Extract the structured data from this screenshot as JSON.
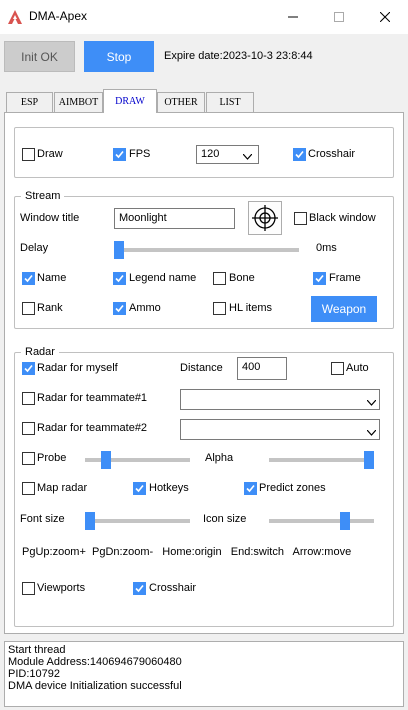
{
  "window": {
    "title": "DMA-Apex",
    "icons": {
      "app": "apex-logo-icon",
      "minimize": "minimize-icon",
      "maximize": "maximize-icon",
      "close": "close-icon"
    }
  },
  "top": {
    "init_label": "Init OK",
    "stop_label": "Stop",
    "expire_text": "Expire date:2023-10-3 23:8:44"
  },
  "tabs": [
    {
      "label": "ESP",
      "active": false
    },
    {
      "label": "AIMBOT",
      "active": false
    },
    {
      "label": "DRAW",
      "active": true
    },
    {
      "label": "OTHER",
      "active": false
    },
    {
      "label": "LIST",
      "active": false
    }
  ],
  "draw_row": {
    "draw": {
      "label": "Draw",
      "checked": false
    },
    "fps": {
      "label": "FPS",
      "checked": true
    },
    "fps_value": "120",
    "crosshair": {
      "label": "Crosshair",
      "checked": true
    }
  },
  "stream": {
    "title": "Stream",
    "window_title_label": "Window title",
    "window_title_value": "Moonlight",
    "black_window": {
      "label": "Black window",
      "checked": false
    },
    "delay_label": "Delay",
    "delay_value": "0ms",
    "delay_level": 0,
    "name": {
      "label": "Name",
      "checked": true
    },
    "legend_name": {
      "label": "Legend name",
      "checked": true
    },
    "bone": {
      "label": "Bone",
      "checked": false
    },
    "frame": {
      "label": "Frame",
      "checked": true
    },
    "rank": {
      "label": "Rank",
      "checked": false
    },
    "ammo": {
      "label": "Ammo",
      "checked": true
    },
    "hl_items": {
      "label": "HL items",
      "checked": false
    },
    "weapon_label": "Weapon"
  },
  "radar": {
    "title": "Radar",
    "for_myself": {
      "label": "Radar for myself",
      "checked": true
    },
    "distance_label": "Distance",
    "distance_value": "400",
    "auto": {
      "label": "Auto",
      "checked": false
    },
    "teammate1": {
      "label": "Radar for teammate#1",
      "checked": false,
      "value": ""
    },
    "teammate2": {
      "label": "Radar for teammate#2",
      "checked": false,
      "value": ""
    },
    "probe": {
      "label": "Probe",
      "checked": false,
      "level": 0.15
    },
    "alpha": {
      "label": "Alpha",
      "level": 1.0
    },
    "map_radar": {
      "label": "Map radar",
      "checked": false
    },
    "hotkeys": {
      "label": "Hotkeys",
      "checked": true
    },
    "predict_zones": {
      "label": "Predict zones",
      "checked": true
    },
    "font_size": {
      "label": "Font size",
      "level": 0.0
    },
    "icon_size": {
      "label": "Icon size",
      "level": 0.73
    },
    "help_text": "PgUp:zoom+  PgDn:zoom-   Home:origin   End:switch   Arrow:move",
    "viewports": {
      "label": "Viewports",
      "checked": false
    },
    "crosshair": {
      "label": "Crosshair",
      "checked": true
    }
  },
  "log": [
    "Start thread",
    "Module Address:140694679060480",
    "PID:10792",
    "DMA device Initialization successful"
  ],
  "colors": {
    "accent": "#3e8ef7",
    "panel": "#ffffff",
    "window": "#f0f0f0"
  }
}
